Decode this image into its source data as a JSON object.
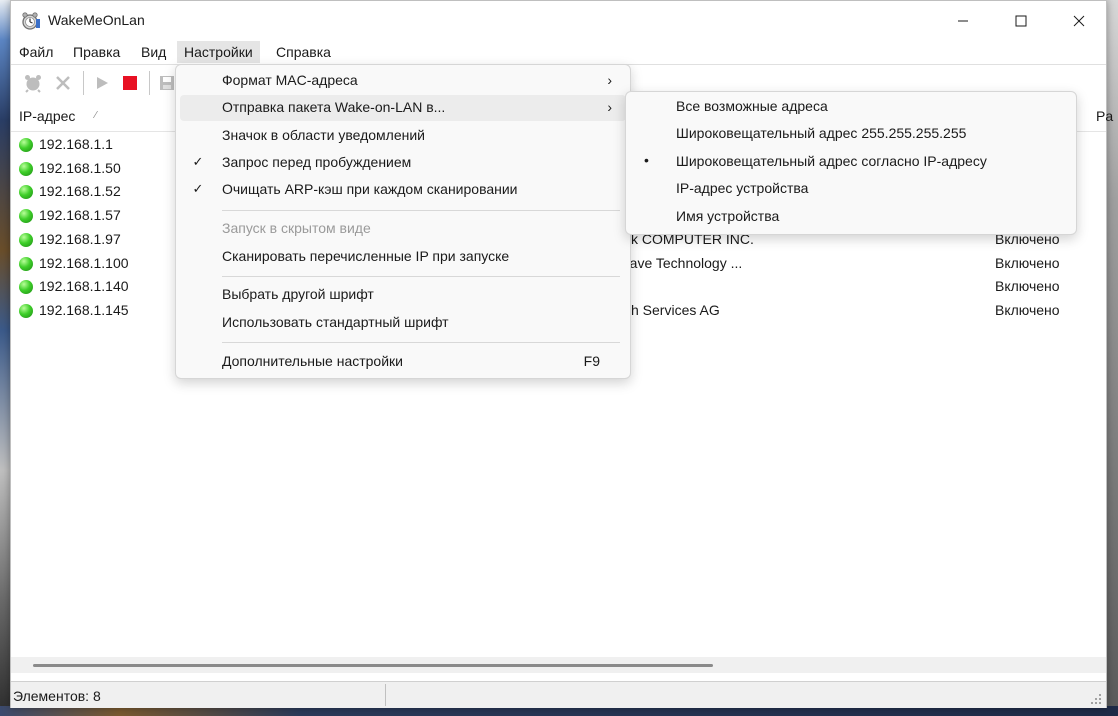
{
  "window": {
    "title": "WakeMeOnLan"
  },
  "colors": {
    "status_green": "#3fcf2a",
    "stop_red": "#e81123"
  },
  "menubar": [
    "Файл",
    "Правка",
    "Вид",
    "Настройки",
    "Справка"
  ],
  "toolbar": {
    "icons": [
      "wake-icon",
      "delete-icon",
      "play-icon",
      "stop-icon",
      "save-icon"
    ]
  },
  "list": {
    "headers": {
      "ip": "IP-адрес",
      "pa": "Pa"
    },
    "rows": [
      {
        "ip": "192.168.1.1",
        "vendor": "",
        "status": ""
      },
      {
        "ip": "192.168.1.50",
        "vendor": "",
        "status": ""
      },
      {
        "ip": "192.168.1.52",
        "vendor": "",
        "status": ""
      },
      {
        "ip": "192.168.1.57",
        "vendor": "",
        "status": ""
      },
      {
        "ip": "192.168.1.97",
        "vendor": "k COMPUTER INC.",
        "status": "Включено"
      },
      {
        "ip": "192.168.1.100",
        "vendor": "'ave Technology ...",
        "status": "Включено"
      },
      {
        "ip": "192.168.1.140",
        "vendor": "",
        "status": "Включено"
      },
      {
        "ip": "192.168.1.145",
        "vendor": "h Services AG",
        "status": "Включено"
      }
    ]
  },
  "status": {
    "items": "Элементов: 8"
  },
  "settings_menu": {
    "items": [
      {
        "label": "Формат MAC-адреса",
        "submenu": true
      },
      {
        "label": "Отправка пакета Wake-on-LAN в...",
        "submenu": true,
        "highlighted": true
      },
      {
        "label": "Значок в области уведомлений"
      },
      {
        "label": "Запрос перед пробуждением",
        "checked": true
      },
      {
        "label": "Очищать ARP-кэш при каждом сканировании",
        "checked": true
      },
      {
        "label": "Запуск в скрытом виде",
        "disabled": true
      },
      {
        "label": "Сканировать перечисленные IP при запуске"
      },
      {
        "label": "Выбрать другой шрифт"
      },
      {
        "label": "Использовать стандартный шрифт"
      },
      {
        "label": "Дополнительные настройки",
        "shortcut": "F9"
      }
    ]
  },
  "wol_submenu": {
    "items": [
      {
        "label": "Все возможные адреса"
      },
      {
        "label": "Широковещательный адрес 255.255.255.255"
      },
      {
        "label": "Широковещательный адрес согласно IP-адресу",
        "selected": true
      },
      {
        "label": "IP-адрес устройства"
      },
      {
        "label": "Имя устройства"
      }
    ]
  }
}
